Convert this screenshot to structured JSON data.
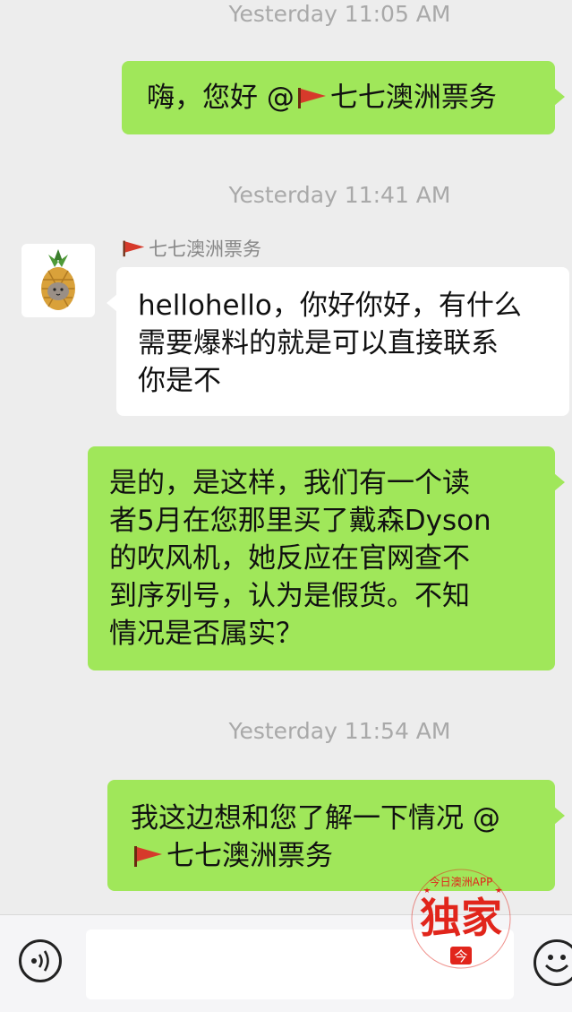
{
  "timestamps": [
    "Yesterday 11:05 AM",
    "Yesterday 11:41 AM",
    "Yesterday 11:54 AM"
  ],
  "messages": [
    {
      "text_before": "嗨，您好 @",
      "text_after": "七七澳洲票务"
    },
    {
      "sender": "七七澳洲票务",
      "lines": [
        "hellohello，你好你好，有什么",
        "需要爆料的就是可以直接联系",
        "你是不"
      ]
    },
    {
      "lines": [
        "是的，是这样，我们有一个读",
        "者5月在您那里买了戴森Dyson",
        "的吹风机，她反应在官网查不",
        "到序列号，认为是假货。不知",
        "情况是否属实？"
      ]
    },
    {
      "line1": "我这边想和您了解一下情况 @",
      "line2": "七七澳洲票务"
    }
  ],
  "watermark": {
    "arc": "今日澳洲APP",
    "main": "独家",
    "badge": "今"
  },
  "colors": {
    "outgoing_bubble": "#a0e75a",
    "incoming_bubble": "#ffffff",
    "background": "#ededed",
    "flag": "#d63a2b",
    "watermark": "#e1251b"
  },
  "icons": {
    "flag": "red-flag-icon",
    "voice": "voice-icon",
    "emoji": "emoji-icon",
    "avatar": "pineapple-cat-avatar"
  }
}
